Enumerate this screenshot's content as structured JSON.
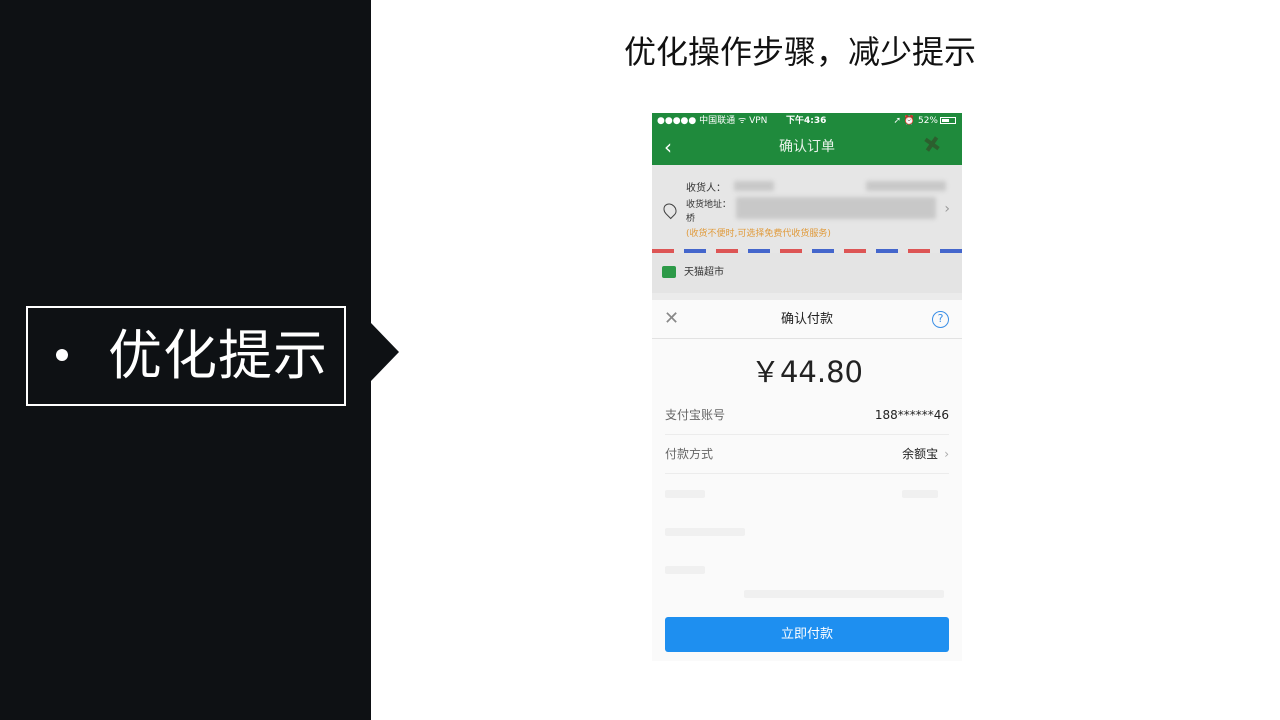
{
  "slide": {
    "title": "优化操作步骤，减少提示",
    "bullet": "优化提示"
  },
  "phone": {
    "status_bar": {
      "carrier": "●●●●● 中国联通 ᯤ VPN",
      "time": "下午4:36",
      "battery": "52%"
    },
    "nav": {
      "back_icon": "chevron-left-icon",
      "title": "确认订单"
    },
    "order": {
      "receiver_label": "收货人：",
      "address_label": "收货地址：",
      "address_line3": "桥",
      "address_note": "(收货不便时,可选择免费代收货服务)",
      "shop_name": "天猫超市"
    },
    "payment_sheet": {
      "title": "确认付款",
      "close_icon": "close-icon",
      "help_icon": "question-icon",
      "amount": "￥44.80",
      "account_label": "支付宝账号",
      "account_value": "188******46",
      "method_label": "付款方式",
      "method_value": "余额宝",
      "pay_button": "立即付款"
    },
    "colors": {
      "nav_green": "#1f8a3c",
      "pay_blue": "#1e8ff0",
      "note_orange": "#e09a3a"
    }
  }
}
